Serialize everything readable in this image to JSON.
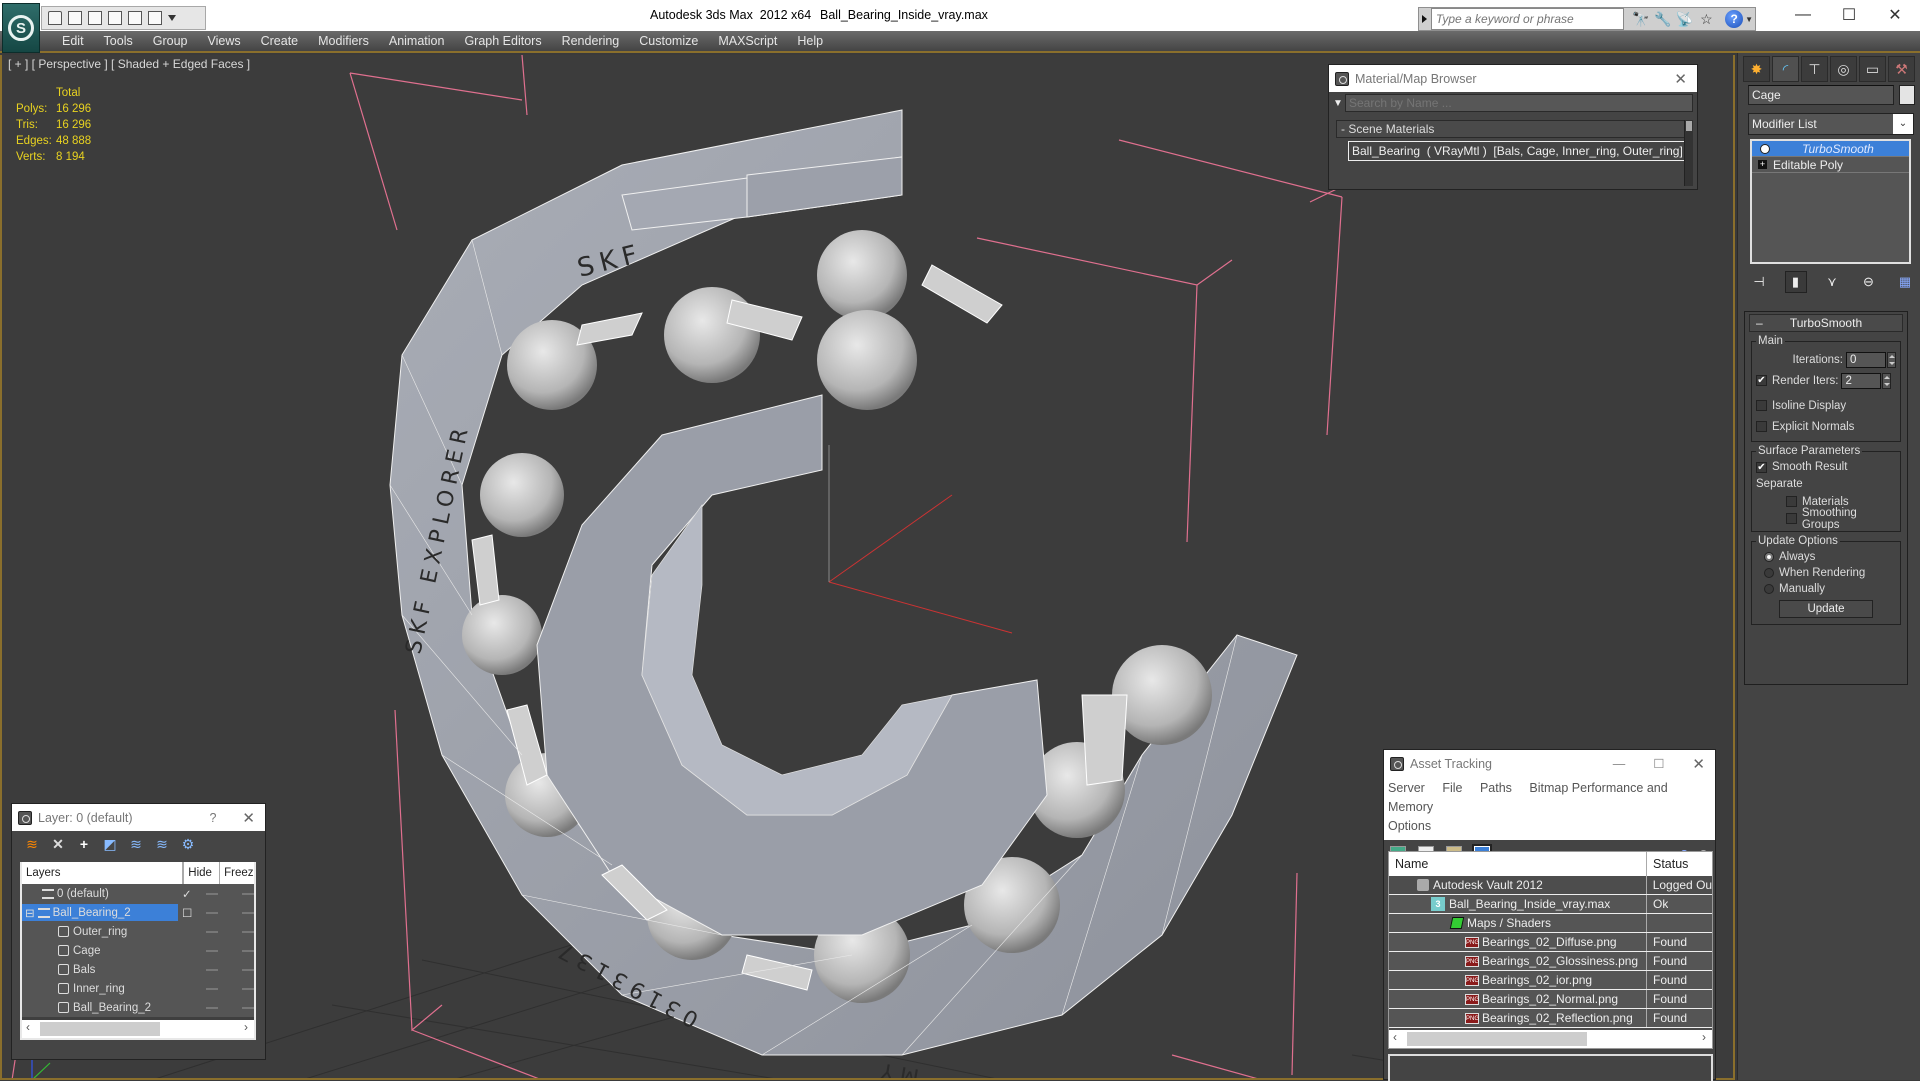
{
  "titlebar": {
    "app_title": "Autodesk 3ds Max  2012 x64",
    "file_name": "Ball_Bearing_Inside_vray.max",
    "search_placeholder": "Type a keyword or phrase",
    "icons": [
      "binoculars-icon",
      "key-icon",
      "satellite-icon",
      "star-icon",
      "help-icon"
    ],
    "window_controls": [
      "minimize",
      "maximize",
      "close"
    ]
  },
  "menu": [
    "Edit",
    "Tools",
    "Group",
    "Views",
    "Create",
    "Modifiers",
    "Animation",
    "Graph Editors",
    "Rendering",
    "Customize",
    "MAXScript",
    "Help"
  ],
  "viewport": {
    "label": "[ + ] [ Perspective ] [ Shaded + Edged Faces ]",
    "stats": {
      "header": "Total",
      "rows": [
        {
          "label": "Polys:",
          "value": "16 296"
        },
        {
          "label": "Tris:",
          "value": "16 296"
        },
        {
          "label": "Edges:",
          "value": "48 888"
        },
        {
          "label": "Verts:",
          "value": "8 194"
        }
      ]
    },
    "model_text": {
      "outer_ring_top": "SKF",
      "outer_ring_side": "SKF EXPLORER",
      "outer_ring_bottom": "03193137",
      "outer_ring_foot": "MY"
    }
  },
  "material_browser": {
    "title": "Material/Map Browser",
    "search_placeholder": "Search by Name ...",
    "group": "- Scene Materials",
    "item": "Ball_Bearing  ( VRayMtl )  [Bals, Cage, Inner_ring, Outer_ring]"
  },
  "command_panel": {
    "tabs": [
      "create",
      "modify",
      "hierarchy",
      "motion",
      "display",
      "utilities"
    ],
    "object_name": "Cage",
    "object_color": "#e4e4e4",
    "modifier_list": "Modifier List",
    "stack": [
      {
        "label": "TurboSmooth",
        "selected": true
      },
      {
        "label": "Editable Poly",
        "selected": false
      }
    ],
    "rollout": {
      "title": "TurboSmooth",
      "main_label": "Main",
      "iterations_label": "Iterations:",
      "iterations_value": "0",
      "render_iters_label": "Render Iters:",
      "render_iters_value": "2",
      "render_iters_checked": true,
      "isoline_label": "Isoline Display",
      "explicit_normals_label": "Explicit Normals",
      "surface_label": "Surface Parameters",
      "smooth_result_label": "Smooth Result",
      "separate_label": "Separate",
      "materials_label": "Materials",
      "smoothing_groups_label": "Smoothing Groups",
      "update_options_label": "Update Options",
      "always_label": "Always",
      "when_rendering_label": "When Rendering",
      "manually_label": "Manually",
      "update_button": "Update"
    }
  },
  "layer_window": {
    "title": "Layer: 0 (default)",
    "help": "?",
    "columns": [
      "Layers",
      "",
      "Hide",
      "Freeze"
    ],
    "rows": [
      {
        "name": "0 (default)",
        "type": "layer",
        "indent": 1,
        "current": "✓"
      },
      {
        "name": "Ball_Bearing_2",
        "type": "layer",
        "indent": 0,
        "selected": true,
        "current": "☐"
      },
      {
        "name": "Outer_ring",
        "type": "object",
        "indent": 2
      },
      {
        "name": "Cage",
        "type": "object",
        "indent": 2
      },
      {
        "name": "Bals",
        "type": "object",
        "indent": 2
      },
      {
        "name": "Inner_ring",
        "type": "object",
        "indent": 2
      },
      {
        "name": "Ball_Bearing_2",
        "type": "object",
        "indent": 2
      }
    ]
  },
  "asset_tracking": {
    "title": "Asset Tracking",
    "menu": [
      "Server",
      "File",
      "Paths",
      "Bitmap Performance and Memory",
      "Options"
    ],
    "columns": [
      "Name",
      "Status"
    ],
    "rows": [
      {
        "name": "Autodesk Vault 2012",
        "status": "Logged Ou",
        "icon": "vault-icon",
        "indent": 1
      },
      {
        "name": "Ball_Bearing_Inside_vray.max",
        "status": "Ok",
        "icon": "max-file-icon",
        "indent": 2
      },
      {
        "name": "Maps / Shaders",
        "status": "",
        "icon": "maps-icon",
        "indent": 3
      },
      {
        "name": "Bearings_02_Diffuse.png",
        "status": "Found",
        "icon": "png-icon",
        "indent": 4
      },
      {
        "name": "Bearings_02_Glossiness.png",
        "status": "Found",
        "icon": "png-icon",
        "indent": 4
      },
      {
        "name": "Bearings_02_ior.png",
        "status": "Found",
        "icon": "png-icon",
        "indent": 4
      },
      {
        "name": "Bearings_02_Normal.png",
        "status": "Found",
        "icon": "png-icon",
        "indent": 4
      },
      {
        "name": "Bearings_02_Reflection.png",
        "status": "Found",
        "icon": "png-icon",
        "indent": 4
      }
    ]
  }
}
